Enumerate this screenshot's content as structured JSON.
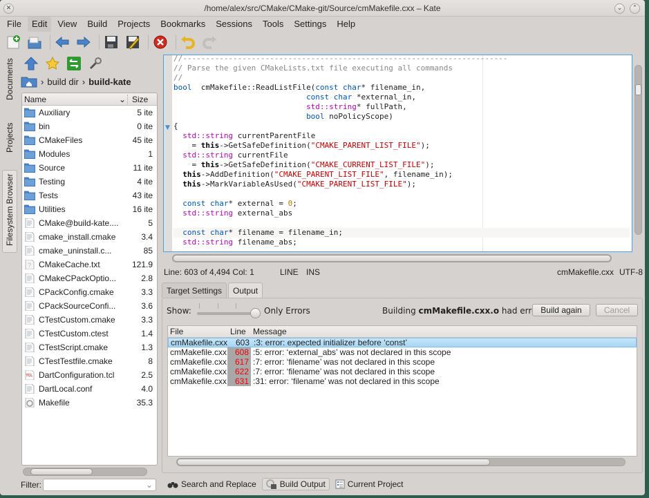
{
  "window": {
    "title": "/home/alex/src/CMake/CMake-git/Source/cmMakefile.cxx – Kate"
  },
  "menubar": [
    {
      "label": "File"
    },
    {
      "label": "Edit",
      "active": true
    },
    {
      "label": "View"
    },
    {
      "label": "Build"
    },
    {
      "label": "Projects"
    },
    {
      "label": "Bookmarks"
    },
    {
      "label": "Sessions"
    },
    {
      "label": "Tools"
    },
    {
      "label": "Settings"
    },
    {
      "label": "Help"
    }
  ],
  "toolbar": {
    "icons": [
      "new-document-icon",
      "open-document-icon",
      "back-icon",
      "forward-icon",
      "save-icon",
      "save-as-icon",
      "close-icon",
      "undo-icon",
      "redo-icon"
    ]
  },
  "sidebar": {
    "tabs": [
      {
        "label": "Documents"
      },
      {
        "label": "Projects"
      },
      {
        "label": "Filesystem Browser",
        "active": true
      }
    ]
  },
  "filebrowser": {
    "breadcrumb": [
      "build dir",
      "build-kate"
    ],
    "columns": {
      "name": "Name",
      "size": "Size"
    },
    "items": [
      {
        "name": "Auxiliary",
        "size": "5 ite",
        "type": "folder"
      },
      {
        "name": "bin",
        "size": "0 ite",
        "type": "folder"
      },
      {
        "name": "CMakeFiles",
        "size": "45 ite",
        "type": "folder"
      },
      {
        "name": "Modules",
        "size": "1",
        "type": "folder"
      },
      {
        "name": "Source",
        "size": "11 ite",
        "type": "folder"
      },
      {
        "name": "Testing",
        "size": "4 ite",
        "type": "folder"
      },
      {
        "name": "Tests",
        "size": "43 ite",
        "type": "folder"
      },
      {
        "name": "Utilities",
        "size": "16 ite",
        "type": "folder"
      },
      {
        "name": "CMake@build-kate....",
        "size": "5",
        "type": "file"
      },
      {
        "name": "cmake_install.cmake",
        "size": "3.4",
        "type": "file"
      },
      {
        "name": "cmake_uninstall.c...",
        "size": "85",
        "type": "file"
      },
      {
        "name": "CMakeCache.txt",
        "size": "121.9",
        "type": "text"
      },
      {
        "name": "CMakeCPackOptio...",
        "size": "2.8",
        "type": "file"
      },
      {
        "name": "CPackConfig.cmake",
        "size": "3.3",
        "type": "file"
      },
      {
        "name": "CPackSourceConfi...",
        "size": "3.6",
        "type": "file"
      },
      {
        "name": "CTestCustom.cmake",
        "size": "3.3",
        "type": "file"
      },
      {
        "name": "CTestCustom.ctest",
        "size": "1.4",
        "type": "file"
      },
      {
        "name": "CTestScript.cmake",
        "size": "1.3",
        "type": "file"
      },
      {
        "name": "CTestTestfile.cmake",
        "size": "8",
        "type": "file"
      },
      {
        "name": "DartConfiguration.tcl",
        "size": "2.5",
        "type": "tcl"
      },
      {
        "name": "DartLocal.conf",
        "size": "4.0",
        "type": "file"
      },
      {
        "name": "Makefile",
        "size": "35.3",
        "type": "make"
      }
    ],
    "filter_label": "Filter:",
    "filter_value": ""
  },
  "editor": {
    "lines": [
      [
        [
          "cm",
          "//-----------------------------------------------------------------------"
        ]
      ],
      [
        [
          "cm",
          "// Parse the given CMakeLists.txt file executing all commands"
        ]
      ],
      [
        [
          "cm",
          "//"
        ]
      ],
      [
        [
          "kw",
          "bool"
        ],
        [
          "",
          "  cmMakefile::ReadListFile("
        ],
        [
          "kw",
          "const char"
        ],
        [
          "",
          "* filename_in,"
        ]
      ],
      [
        [
          "",
          "                             "
        ],
        [
          "kw",
          "const char"
        ],
        [
          "",
          " *external_in,"
        ]
      ],
      [
        [
          "",
          "                             "
        ],
        [
          "ty",
          "std::string"
        ],
        [
          "",
          "* fullPath,"
        ]
      ],
      [
        [
          "",
          "                             "
        ],
        [
          "kw",
          "bool"
        ],
        [
          "",
          " noPolicyScope)"
        ]
      ],
      [
        [
          "",
          "{"
        ]
      ],
      [
        [
          "",
          "  "
        ],
        [
          "ty",
          "std::string"
        ],
        [
          "",
          " currentParentFile"
        ]
      ],
      [
        [
          "",
          "    = "
        ],
        [
          "th",
          "this"
        ],
        [
          "",
          "->GetSafeDefinition("
        ],
        [
          "st",
          "\"CMAKE_PARENT_LIST_FILE\""
        ],
        [
          "",
          ");"
        ]
      ],
      [
        [
          "",
          "  "
        ],
        [
          "ty",
          "std::string"
        ],
        [
          "",
          " currentFile"
        ]
      ],
      [
        [
          "",
          "    = "
        ],
        [
          "th",
          "this"
        ],
        [
          "",
          "->GetSafeDefinition("
        ],
        [
          "st",
          "\"CMAKE_CURRENT_LIST_FILE\""
        ],
        [
          "",
          ");"
        ]
      ],
      [
        [
          "",
          "  "
        ],
        [
          "th",
          "this"
        ],
        [
          "",
          "->AddDefinition("
        ],
        [
          "st",
          "\"CMAKE_PARENT_LIST_FILE\""
        ],
        [
          "",
          ", filename_in);"
        ]
      ],
      [
        [
          "",
          "  "
        ],
        [
          "th",
          "this"
        ],
        [
          "",
          "->MarkVariableAsUsed("
        ],
        [
          "st",
          "\"CMAKE_PARENT_LIST_FILE\""
        ],
        [
          "",
          ");"
        ]
      ],
      [
        [
          "",
          ""
        ]
      ],
      [
        [
          "",
          "  "
        ],
        [
          "kw",
          "const char"
        ],
        [
          "",
          "* external = "
        ],
        [
          "nu",
          "0"
        ],
        [
          "",
          ";"
        ]
      ],
      [
        [
          "",
          "  "
        ],
        [
          "ty",
          "std::string"
        ],
        [
          "",
          " external_abs"
        ]
      ],
      [
        [
          "",
          ""
        ]
      ],
      [
        [
          "",
          "  "
        ],
        [
          "kw",
          "const char"
        ],
        [
          "",
          "* filename = filename_in;"
        ]
      ],
      [
        [
          "",
          "  "
        ],
        [
          "ty",
          "std::string"
        ],
        [
          "",
          " filename_abs;"
        ]
      ]
    ],
    "current_line_index": 18
  },
  "statusbar": {
    "position": "Line: 603 of 4,494 Col: 1",
    "mode": "LINE",
    "insert": "INS",
    "filename": "cmMakefile.cxx",
    "encoding": "UTF-8"
  },
  "build": {
    "tabs": [
      {
        "label": "Target Settings"
      },
      {
        "label": "Output",
        "active": true
      }
    ],
    "show_label": "Show:",
    "filter_level": "Only Errors",
    "slider_value": 4,
    "slider_max": 4,
    "status_prefix": "Building",
    "status_target": "cmMakefile.cxx.o",
    "status_suffix": "had errors.",
    "build_again": "Build again",
    "cancel": "Cancel",
    "columns": {
      "file": "File",
      "line": "Line",
      "message": "Message"
    },
    "errors": [
      {
        "file": "cmMakefile.cxx",
        "line": "603",
        "message": ":3: error: expected initializer before ‘const’",
        "selected": true
      },
      {
        "file": "cmMakefile.cxx",
        "line": "608",
        "message": ":5: error: ‘external_abs’ was not declared in this scope"
      },
      {
        "file": "cmMakefile.cxx",
        "line": "617",
        "message": ":7: error: ‘filename’ was not declared in this scope"
      },
      {
        "file": "cmMakefile.cxx",
        "line": "622",
        "message": ":7: error: ‘filename’ was not declared in this scope"
      },
      {
        "file": "cmMakefile.cxx",
        "line": "631",
        "message": ":31: error: ‘filename’ was not declared in this scope"
      }
    ]
  },
  "bottom_tabs": [
    {
      "label": "Search and Replace",
      "icon": "binoculars-icon"
    },
    {
      "label": "Build Output",
      "icon": "build-icon",
      "active": true
    },
    {
      "label": "Current Project",
      "icon": "project-icon"
    }
  ]
}
